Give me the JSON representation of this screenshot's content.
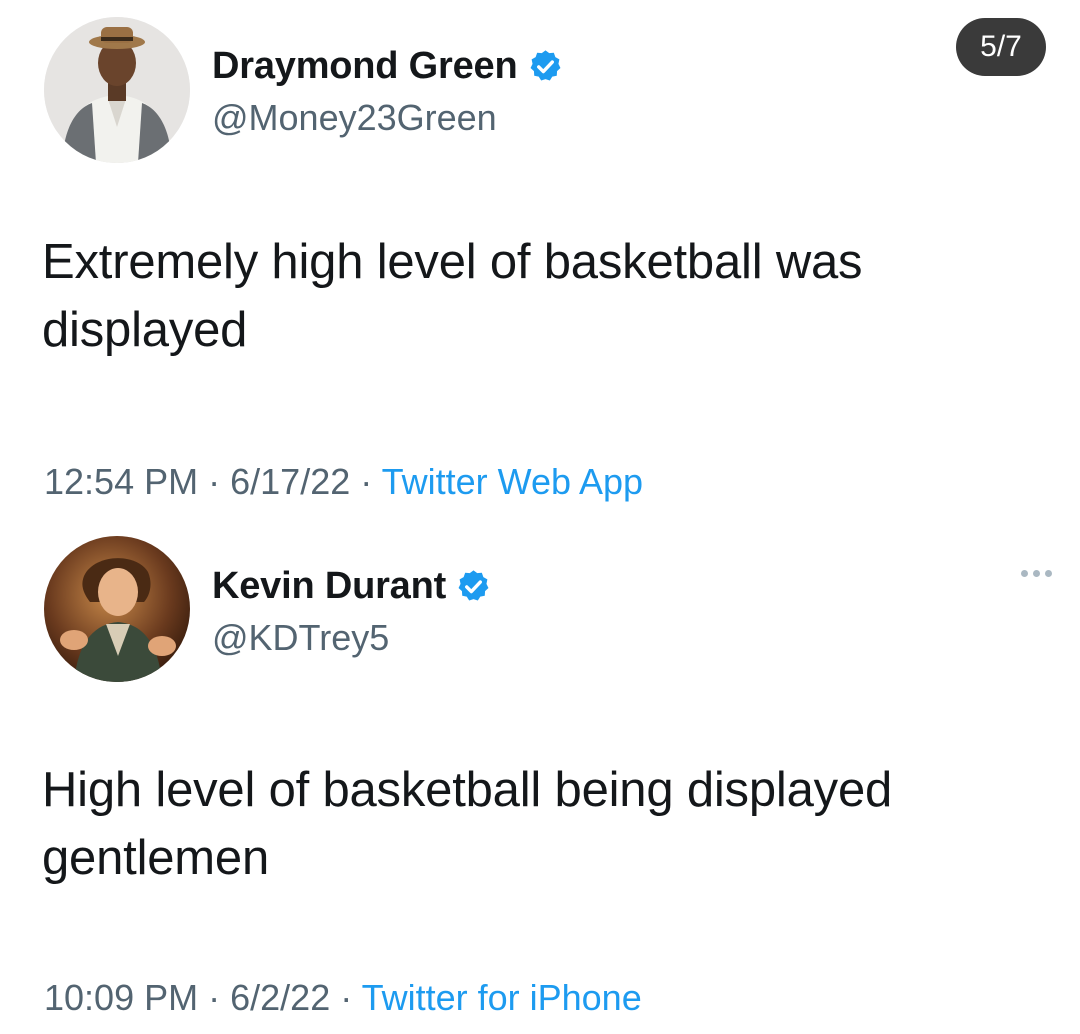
{
  "pager": {
    "label": "5/7"
  },
  "tweets": [
    {
      "display_name": "Draymond Green",
      "handle": "@Money23Green",
      "body": "Extremely high level of basketball was displayed",
      "time": "12:54 PM",
      "date": "6/17/22",
      "source": "Twitter Web App",
      "separator": "·",
      "verified": true
    },
    {
      "display_name": "Kevin Durant",
      "handle": "@KDTrey5",
      "body": "High level of basketball being displayed gentlemen",
      "time": "10:09 PM",
      "date": "6/2/22",
      "source": "Twitter for iPhone",
      "separator": "·",
      "verified": true
    }
  ],
  "colors": {
    "accent": "#1d9bf0",
    "text": "#14171a",
    "secondary": "#536471",
    "badge_bg": "#3a3a3a"
  },
  "icons": {
    "verified": "verified-badge-icon",
    "more": "more-horizontal-icon"
  }
}
